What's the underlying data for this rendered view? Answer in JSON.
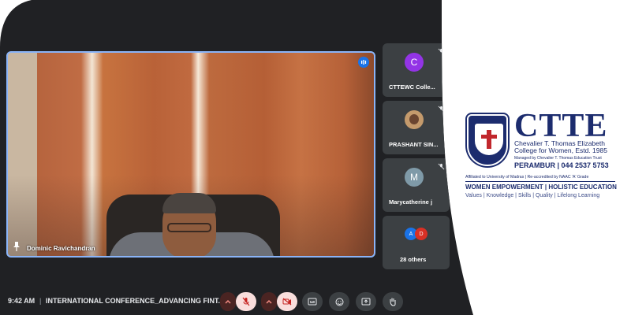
{
  "main_tile": {
    "participant_name": "Dominic Ravichandran",
    "speaking_indicator": "speaking-icon",
    "pin_icon": "pin-icon"
  },
  "side_tiles": [
    {
      "avatar_letter": "C",
      "label": "CTTEWC Colle...",
      "avatar_color": "#9334e6"
    },
    {
      "avatar_letter": "",
      "label": "PRASHANT SIN...",
      "avatar_color": "#c49a6c"
    },
    {
      "avatar_letter": "M",
      "label": "Marycatherine j",
      "avatar_color": "#7f9aa8"
    },
    {
      "label": "28 others",
      "avatars": [
        "A",
        "D"
      ]
    }
  ],
  "bottom_bar": {
    "time": "9:42 AM",
    "divider": "|",
    "meeting_title": "INTERNATIONAL CONFERENCE_ADVANCING FINT...",
    "controls": [
      "mic-options",
      "mic-off",
      "camera-options",
      "camera-off",
      "captions",
      "emoji",
      "present",
      "raise-hand"
    ]
  },
  "logo": {
    "brand": "CTTE",
    "college_line1": "Chevalier T. Thomas Elizabeth",
    "college_line2": "College for Women, Estd. 1985",
    "trust": "Managed by Chevalier T. Thomas Education Trust",
    "location": "PERAMBUR | 044 2537 5753",
    "affiliation": "Affiliated to University of Madras | Re-accredited by NAAC 'A' Grade",
    "tagline": "WOMEN EMPOWERMENT | HOLISTIC EDUCATION",
    "values": "Values | Knowledge | Skills | Quality | Lifelong Learning"
  },
  "colors": {
    "meet_bg": "#202124",
    "tile_bg": "#3c4043",
    "active_border": "#8ab4f8",
    "brand_navy": "#1c2c6e",
    "alert_red": "#c5221f"
  }
}
